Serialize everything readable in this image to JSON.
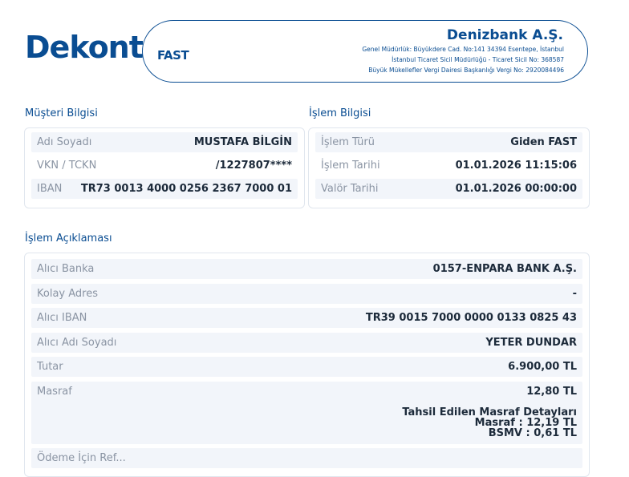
{
  "header": {
    "title": "Dekont",
    "type": "FAST",
    "bank_name": "Denizbank A.Ş.",
    "address_line": "Genel Müdürlük: Büyükdere Cad. No:141 34394 Esentepe, İstanbul",
    "registry_line": "İstanbul Ticaret Sicil Müdürlüğü - Ticaret Sicil No: 368587",
    "tax_line": "Büyük Mükellefler Vergi Dairesi Başkanlığı Vergi No: 2920084496"
  },
  "customer": {
    "section_title": "Müşteri Bilgisi",
    "rows": [
      {
        "label": "Adı Soyadı",
        "value": "MUSTAFA BİLGİN"
      },
      {
        "label": "VKN / TCKN",
        "value": "/1227807****"
      },
      {
        "label": "IBAN",
        "value": "TR73 0013 4000 0256 2367 7000 01"
      }
    ]
  },
  "transaction": {
    "section_title": "İşlem Bilgisi",
    "rows": [
      {
        "label": "İşlem Türü",
        "value": "Giden FAST"
      },
      {
        "label": "İşlem Tarihi",
        "value": "01.01.2026 11:15:06"
      },
      {
        "label": "Valör Tarihi",
        "value": "01.01.2026 00:00:00"
      }
    ]
  },
  "description": {
    "section_title": "İşlem Açıklaması",
    "rows": [
      {
        "label": "Alıcı Banka",
        "value": "0157-ENPARA BANK A.Ş."
      },
      {
        "label": "Kolay Adres",
        "value": "-"
      },
      {
        "label": "Alıcı IBAN",
        "value": "TR39 0015 7000 0000 0133 0825 43"
      },
      {
        "label": "Alıcı Adı Soyadı",
        "value": "YETER DUNDAR"
      },
      {
        "label": "Tutar",
        "value": "6.900,00 TL"
      },
      {
        "label": "Masraf",
        "value": "12,80 TL"
      }
    ],
    "fee_details": {
      "title": "Tahsil Edilen Masraf Detayları",
      "fee_line": "Masraf   : 12,19 TL",
      "bsmv_line": "BSMV   : 0,61 TL"
    },
    "next_label": "Ödeme İçin Ref..."
  }
}
